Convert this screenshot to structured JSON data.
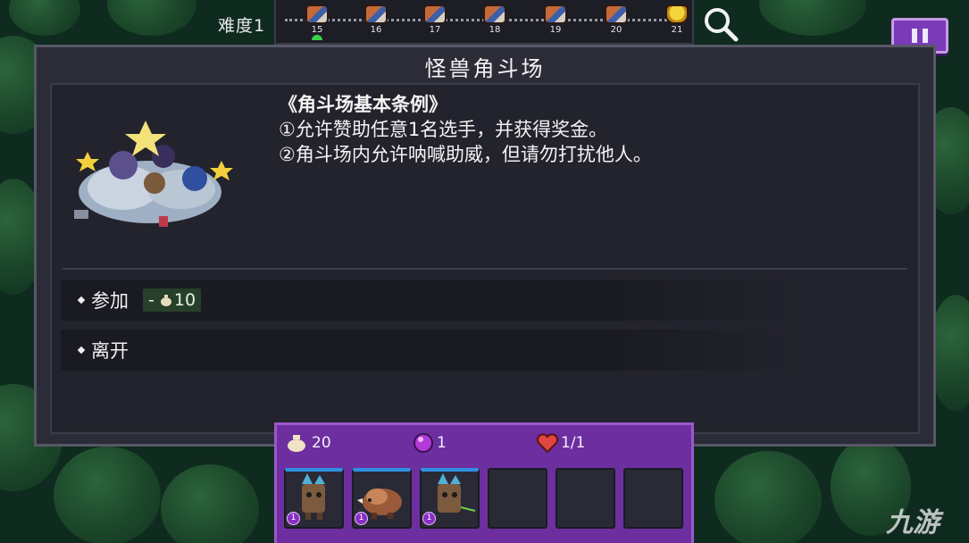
{
  "difficulty": {
    "label": "难度1"
  },
  "stages": [
    {
      "num": "15",
      "icon": "monster-group-icon",
      "current": true
    },
    {
      "num": "16",
      "icon": "monster-group-icon",
      "current": false
    },
    {
      "num": "17",
      "icon": "monster-group-icon",
      "current": false
    },
    {
      "num": "18",
      "icon": "monster-group-icon",
      "current": false
    },
    {
      "num": "19",
      "icon": "monster-group-icon",
      "current": false
    },
    {
      "num": "20",
      "icon": "monster-group-icon",
      "current": false
    },
    {
      "num": "21",
      "icon": "trophy-icon",
      "current": false
    }
  ],
  "panel": {
    "title": "怪兽角斗场",
    "rules": {
      "title": "《角斗场基本条例》",
      "line1": "①允许赞助任意1名选手，并获得奖金。",
      "line2": "②角斗场内允许呐喊助威，但请勿打扰他人。"
    },
    "options": [
      {
        "label": "参加",
        "cost_sign": "-",
        "cost_value": "10",
        "cost_icon": "money-bag-icon"
      },
      {
        "label": "离开"
      }
    ]
  },
  "inventory": {
    "gold": "20",
    "gems": "1",
    "hearts": "1/1",
    "slots": [
      {
        "filled": true,
        "creature": "tree-stump-monster",
        "level": "1"
      },
      {
        "filled": true,
        "creature": "boar-monster",
        "level": "1"
      },
      {
        "filled": true,
        "creature": "tree-stump-monster",
        "level": "1"
      },
      {
        "filled": false
      },
      {
        "filled": false
      },
      {
        "filled": false
      }
    ]
  },
  "watermark": "九游",
  "colors": {
    "inventory_bg": "#6d2f9f",
    "pause_button": "#7a3bb8",
    "slot_active": "#2f8fe0",
    "cost_bg": "#27402a"
  }
}
